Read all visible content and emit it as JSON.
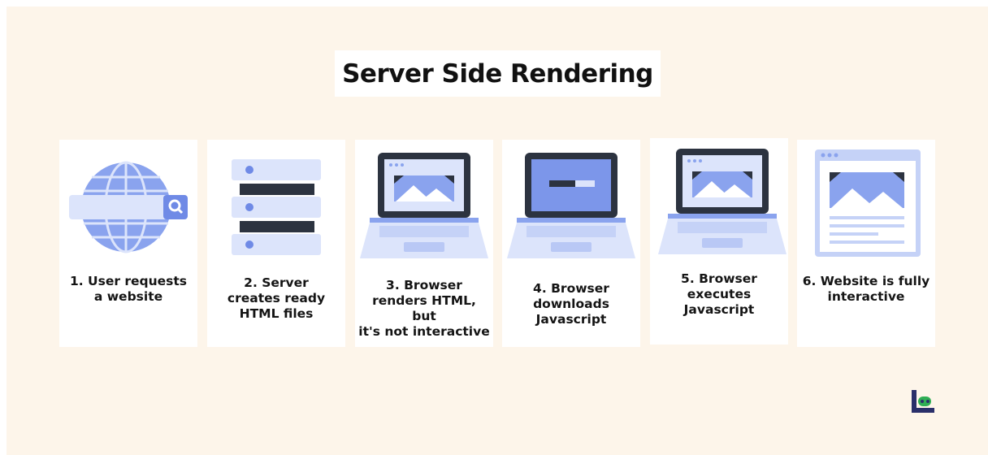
{
  "title": "Server Side Rendering",
  "steps": [
    {
      "label": "1. User requests\na website",
      "icon": "globe-search-icon"
    },
    {
      "label": "2.  Server\ncreates ready\nHTML files",
      "icon": "server-stack-icon"
    },
    {
      "label": "3. Browser\nrenders HTML, but\nit's not interactive",
      "icon": "laptop-rendered-page-icon"
    },
    {
      "label": "4. Browser\ndownloads\nJavascript",
      "icon": "laptop-download-icon"
    },
    {
      "label": "5. Browser\nexecutes\nJavascript",
      "icon": "laptop-executing-icon"
    },
    {
      "label": "6. Website is fully\ninteractive",
      "icon": "web-page-icon"
    }
  ],
  "colors": {
    "background": "#fdf5ea",
    "card": "#ffffff",
    "blue": "#8aa3ee",
    "light_blue": "#dce4fb",
    "dark": "#2c3340",
    "navy": "#2a2f6a",
    "green": "#2fae54"
  },
  "brand_logo": "brand-logo"
}
